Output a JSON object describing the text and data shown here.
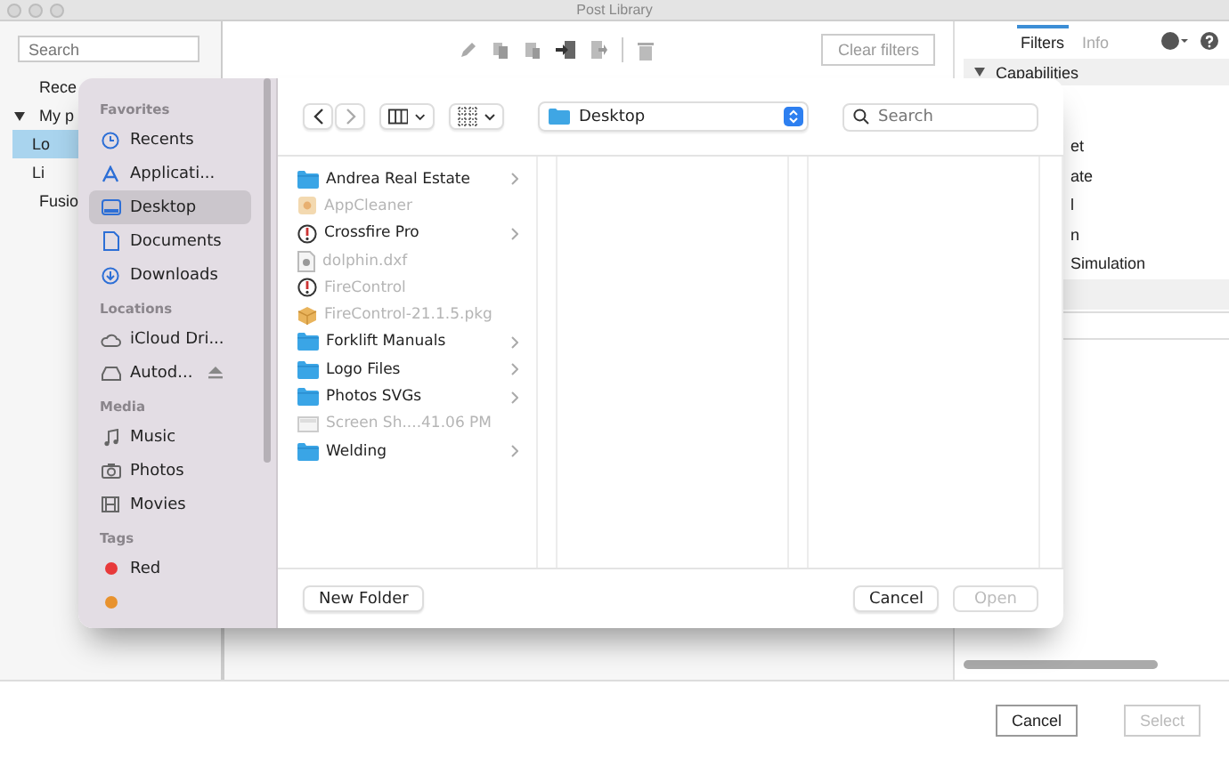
{
  "window": {
    "title": "Post Library"
  },
  "left_pane": {
    "search": {
      "placeholder": "Search"
    },
    "tree": [
      {
        "label": "Rece",
        "selected": false
      },
      {
        "label": "My p",
        "selected": false,
        "expanded": true,
        "children": [
          {
            "label": "Lo",
            "selected": true
          },
          {
            "label": "Li",
            "selected": false
          }
        ]
      },
      {
        "label": "Fusio",
        "selected": false
      }
    ]
  },
  "toolbar": {
    "clear_filters": "Clear filters"
  },
  "right_pane": {
    "tabs": [
      {
        "label": "Filters",
        "selected": true
      },
      {
        "label": "Info",
        "selected": false
      }
    ],
    "section": {
      "label": "Capabilities",
      "expanded": true,
      "items": [
        "et",
        "ate",
        "l",
        "n",
        "Simulation"
      ]
    }
  },
  "footer": {
    "buttons": [
      {
        "label": "Cancel",
        "disabled": false
      },
      {
        "label": "Select",
        "disabled": true
      }
    ]
  },
  "dialog": {
    "sidebar": [
      {
        "heading": "Favorites",
        "items": [
          {
            "label": "Recents",
            "kind": "recents",
            "selected": false
          },
          {
            "label": "Applicati...",
            "kind": "applications",
            "selected": false
          },
          {
            "label": "Desktop",
            "kind": "desktop",
            "selected": true
          },
          {
            "label": "Documents",
            "kind": "documents",
            "selected": false
          },
          {
            "label": "Downloads",
            "kind": "downloads",
            "selected": false
          }
        ]
      },
      {
        "heading": "Locations",
        "items": [
          {
            "label": "iCloud Dri...",
            "kind": "cloud",
            "selected": false
          },
          {
            "label": "Autod...",
            "kind": "disk",
            "selected": false,
            "eject": true
          }
        ]
      },
      {
        "heading": "Media",
        "items": [
          {
            "label": "Music",
            "kind": "music",
            "selected": false
          },
          {
            "label": "Photos",
            "kind": "photos",
            "selected": false
          },
          {
            "label": "Movies",
            "kind": "movies",
            "selected": false
          }
        ]
      },
      {
        "heading": "Tags",
        "items": [
          {
            "label": "Red",
            "kind": "tag",
            "color": "#e8393a",
            "selected": false
          },
          {
            "kind": "tag",
            "color": "#e8922e",
            "selected": false
          }
        ]
      }
    ],
    "location": "Desktop",
    "search": {
      "placeholder": "Search"
    },
    "files": [
      {
        "name": "Andrea Real Estate",
        "kind": "folder",
        "disabled": false,
        "has_children": true
      },
      {
        "name": "AppCleaner",
        "kind": "app",
        "disabled": true,
        "has_children": false
      },
      {
        "name": "Crossfire Pro",
        "kind": "gauge",
        "disabled": false,
        "has_children": true
      },
      {
        "name": "dolphin.dxf",
        "kind": "file",
        "disabled": true,
        "has_children": false
      },
      {
        "name": "FireControl",
        "kind": "gauge",
        "disabled": true,
        "has_children": false
      },
      {
        "name": "FireControl-21.1.5.pkg",
        "kind": "package",
        "disabled": true,
        "has_children": false
      },
      {
        "name": "Forklift Manuals",
        "kind": "folder",
        "disabled": false,
        "has_children": true
      },
      {
        "name": "Logo Files",
        "kind": "folder",
        "disabled": false,
        "has_children": true
      },
      {
        "name": "Photos SVGs",
        "kind": "folder",
        "disabled": false,
        "has_children": true
      },
      {
        "name": "Screen Sh....41.06 PM",
        "kind": "image",
        "disabled": true,
        "has_children": false
      },
      {
        "name": "Welding",
        "kind": "folder",
        "disabled": false,
        "has_children": true
      }
    ],
    "new_folder": "New Folder",
    "buttons": [
      {
        "label": "Cancel",
        "disabled": false
      },
      {
        "label": "Open",
        "disabled": true
      }
    ]
  }
}
